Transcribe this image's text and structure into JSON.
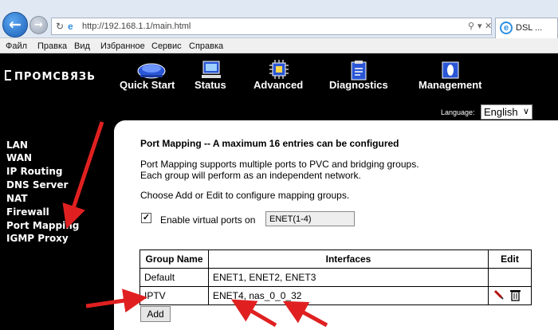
{
  "browser": {
    "url": "http://192.168.1.1/main.html",
    "tab_title": "DSL ...",
    "menu": [
      "Файл",
      "Правка",
      "Вид",
      "Избранное",
      "Сервис",
      "Справка"
    ]
  },
  "router": {
    "logo_text": "ПРОМСВЯЗЬ",
    "top_nav": [
      "Quick Start",
      "Status",
      "Advanced",
      "Diagnostics",
      "Management"
    ],
    "language_label": "Language:",
    "language_value": "English",
    "sidebar": [
      "LAN",
      "WAN",
      "IP Routing",
      "DNS Server",
      "NAT",
      "Firewall",
      "Port Mapping",
      "IGMP Proxy"
    ]
  },
  "content": {
    "title": "Port Mapping -- A maximum 16 entries can be configured",
    "desc_1": "Port Mapping supports multiple ports to PVC and bridging groups.",
    "desc_2": "Each group will perform as an independent network.",
    "instructions": "Choose Add or Edit to configure mapping groups.",
    "virtual_ports_label": "Enable virtual ports on",
    "virtual_ports_checked": true,
    "virtual_ports_value": "ENET(1-4)",
    "table": {
      "headers": [
        "Group Name",
        "Interfaces",
        "Edit"
      ],
      "rows": [
        {
          "group": "Default",
          "interfaces": "ENET1, ENET2, ENET3"
        },
        {
          "group": "IPTV",
          "interfaces": "ENET4, nas_0_0_32"
        }
      ]
    },
    "add_label": "Add"
  },
  "colors": {
    "arrow": "#e02020",
    "page_bg": "#000000",
    "content_bg": "#ffffff"
  }
}
